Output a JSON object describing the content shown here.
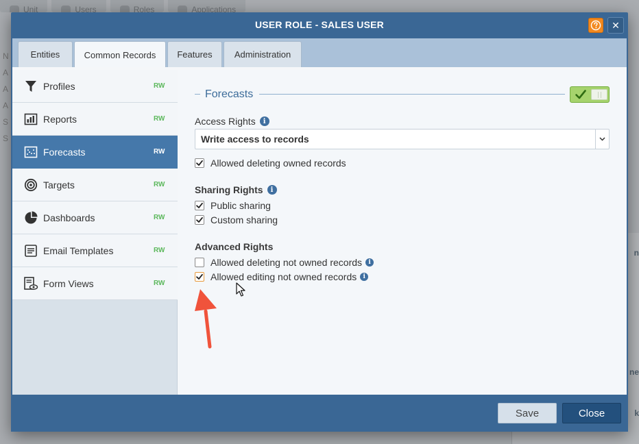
{
  "background": {
    "tabs": [
      "Unit",
      "Users",
      "Roles",
      "Applications"
    ],
    "left_letters": [
      "N",
      "A",
      "A",
      "A",
      "S",
      "S"
    ],
    "right_fragments": [
      "n",
      "ne",
      "k"
    ]
  },
  "dialog": {
    "title": "USER ROLE - SALES USER",
    "help_label": "?",
    "close_label": "✕"
  },
  "tabs": [
    {
      "label": "Entities",
      "active": false
    },
    {
      "label": "Common Records",
      "active": true
    },
    {
      "label": "Features",
      "active": false
    },
    {
      "label": "Administration",
      "active": false
    }
  ],
  "sidebar": {
    "items": [
      {
        "label": "Profiles",
        "badge": "RW",
        "icon": "funnel-icon"
      },
      {
        "label": "Reports",
        "badge": "RW",
        "icon": "report-chart-icon"
      },
      {
        "label": "Forecasts",
        "badge": "RW",
        "icon": "forecast-icon",
        "active": true
      },
      {
        "label": "Targets",
        "badge": "RW",
        "icon": "target-icon"
      },
      {
        "label": "Dashboards",
        "badge": "RW",
        "icon": "pie-chart-icon"
      },
      {
        "label": "Email Templates",
        "badge": "RW",
        "icon": "document-icon"
      },
      {
        "label": "Form Views",
        "badge": "RW",
        "icon": "form-view-icon"
      }
    ]
  },
  "main": {
    "section_title": "Forecasts",
    "toggle_on": true,
    "access_rights": {
      "label": "Access Rights",
      "selected": "Write access to records",
      "options": [
        {
          "label": "Allowed deleting owned records",
          "checked": true
        }
      ]
    },
    "sharing_rights": {
      "label": "Sharing Rights",
      "options": [
        {
          "label": "Public sharing",
          "checked": true
        },
        {
          "label": "Custom sharing",
          "checked": true
        }
      ]
    },
    "advanced_rights": {
      "label": "Advanced Rights",
      "options": [
        {
          "label": "Allowed deleting not owned records",
          "checked": false
        },
        {
          "label": "Allowed editing not owned records",
          "checked": true
        }
      ]
    }
  },
  "footer": {
    "save_label": "Save",
    "close_label": "Close"
  },
  "colors": {
    "dialog_blue": "#3a6795",
    "active_item": "#4578aa",
    "badge_green": "#5cb85c",
    "toggle_green": "#a6d36d",
    "help_orange": "#f2891f",
    "annotation_red": "#f0533b"
  }
}
